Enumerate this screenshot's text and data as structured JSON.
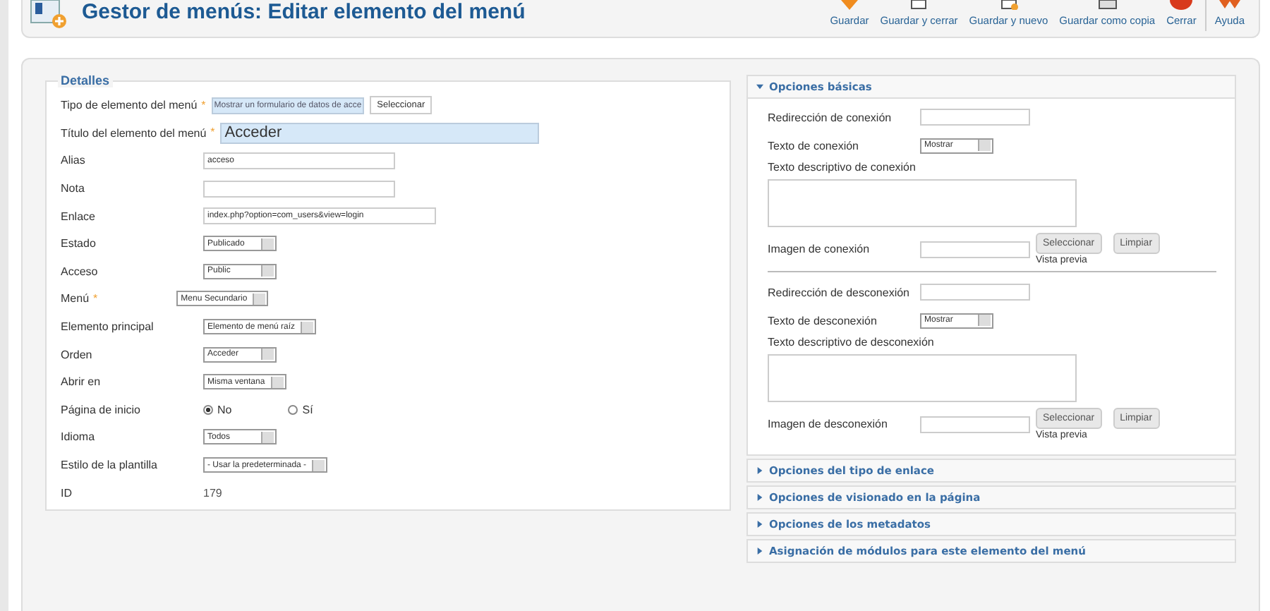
{
  "header": {
    "title": "Gestor de menús: Editar elemento del menú"
  },
  "toolbar": [
    {
      "label": "Guardar",
      "kind": "save"
    },
    {
      "label": "Guardar y cerrar",
      "kind": "saveclose"
    },
    {
      "label": "Guardar y nuevo",
      "kind": "savenew"
    },
    {
      "label": "Guardar como copia",
      "kind": "copy"
    },
    {
      "label": "Cerrar",
      "kind": "close"
    },
    {
      "label": "Ayuda",
      "kind": "help"
    }
  ],
  "details": {
    "legend": "Detalles",
    "fields": [
      {
        "label": "Tipo de elemento del menú",
        "required_mark": "*",
        "kind": "type",
        "value": "Mostrar un formulario de datos de acce",
        "button": "Seleccionar"
      },
      {
        "label": "Título del elemento del menú",
        "required_mark": "*",
        "kind": "title",
        "value": "Acceder"
      },
      {
        "label": "Alias",
        "kind": "input",
        "value": "acceso"
      },
      {
        "label": "Nota",
        "kind": "input"
      },
      {
        "label": "Enlace",
        "kind": "link",
        "value": "index.php?option=com_users&view=login"
      },
      {
        "label": "Estado",
        "kind": "select",
        "value": "Publicado"
      },
      {
        "label": "Acceso",
        "kind": "select",
        "value": "Public"
      },
      {
        "label": "Menú",
        "required_mark": "*",
        "kind": "select",
        "value": "Menu Secundario"
      },
      {
        "label": "Elemento principal",
        "kind": "select",
        "value": "Elemento de menú raíz"
      },
      {
        "label": "Orden",
        "kind": "select",
        "value": "Acceder"
      },
      {
        "label": "Abrir en",
        "kind": "select",
        "value": "Misma ventana"
      },
      {
        "label": "Página de inicio",
        "kind": "radio",
        "options": [
          {
            "label": "No",
            "selected": true
          },
          {
            "label": "Sí",
            "selected": false
          }
        ]
      },
      {
        "label": "Idioma",
        "kind": "select",
        "value": "Todos"
      },
      {
        "label": "Estilo de la plantilla",
        "kind": "select",
        "value": "- Usar la predeterminada -"
      },
      {
        "label": "ID",
        "kind": "text",
        "value": "179"
      }
    ]
  },
  "panels": [
    {
      "title": "Opciones básicas",
      "expanded": true,
      "fields": [
        {
          "label": "Redirección de conexión",
          "kind": "input"
        },
        {
          "label": "Texto de conexión",
          "kind": "select",
          "value": "Mostrar"
        },
        {
          "label": "Texto descriptivo de conexión",
          "kind": "textarea"
        },
        {
          "label": "Imagen de conexión",
          "kind": "image",
          "buttons": [
            "Seleccionar",
            "Limpiar"
          ],
          "preview": "Vista previa"
        },
        {
          "kind": "separator"
        },
        {
          "label": "Redirección de desconexión",
          "kind": "input"
        },
        {
          "label": "Texto de desconexión",
          "kind": "select",
          "value": "Mostrar"
        },
        {
          "label": "Texto descriptivo de desconexión",
          "kind": "textarea"
        },
        {
          "label": "Imagen de desconexión",
          "kind": "image",
          "buttons": [
            "Seleccionar",
            "Limpiar"
          ],
          "preview": "Vista previa"
        }
      ]
    },
    {
      "title": "Opciones del tipo de enlace",
      "expanded": false
    },
    {
      "title": "Opciones de visionado en la página",
      "expanded": false
    },
    {
      "title": "Opciones de los metadatos",
      "expanded": false
    },
    {
      "title": "Asignación de módulos para este elemento del menú",
      "expanded": false
    }
  ]
}
